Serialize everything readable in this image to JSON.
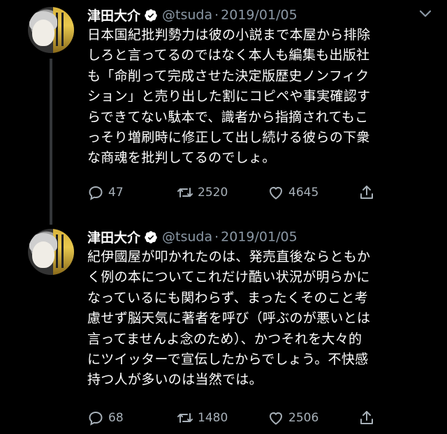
{
  "tweets": [
    {
      "author": "津田大介",
      "handle": "@tsuda",
      "separator": "·",
      "date": "2019/01/05",
      "text": "日本国紀批判勢力は彼の小説まで本屋から排除\nしろと言ってるのではなく本人も編集も出版社\nも「命削って完成させた決定版歴史ノンフィク\nション」と売り出した割にコピペや事実確認す\nらできてない駄本で、識者から指摘されてもこ\nっそり増刷時に修正して出し続ける彼らの下衆\nな商魂を批判してるのでしょ。",
      "replies": "47",
      "retweets": "2520",
      "likes": "4645"
    },
    {
      "author": "津田大介",
      "handle": "@tsuda",
      "separator": "·",
      "date": "2019/01/05",
      "text": "紀伊國屋が叩かれたのは、発売直後ならともか\nく例の本についてこれだけ酷い状況が明らかに\nなっているにも関わらず、まったくそのこと考\n慮せず脳天気に著者を呼び（呼ぶのが悪いとは\n言ってませんよ念のため）、かつそれを大々的\nにツイッターで宣伝したからでしょう。不快感\n持つ人が多いのは当然では。",
      "replies": "68",
      "retweets": "1480",
      "likes": "2506"
    }
  ],
  "icons": {
    "verified": "verified-badge-icon",
    "more": "chevron-down-icon",
    "reply": "reply-icon",
    "retweet": "retweet-icon",
    "like": "heart-icon",
    "share": "share-icon"
  },
  "colors": {
    "background": "#000000",
    "text": "#ffffff",
    "secondary": "#8b98a5",
    "thread_line": "#333639"
  }
}
